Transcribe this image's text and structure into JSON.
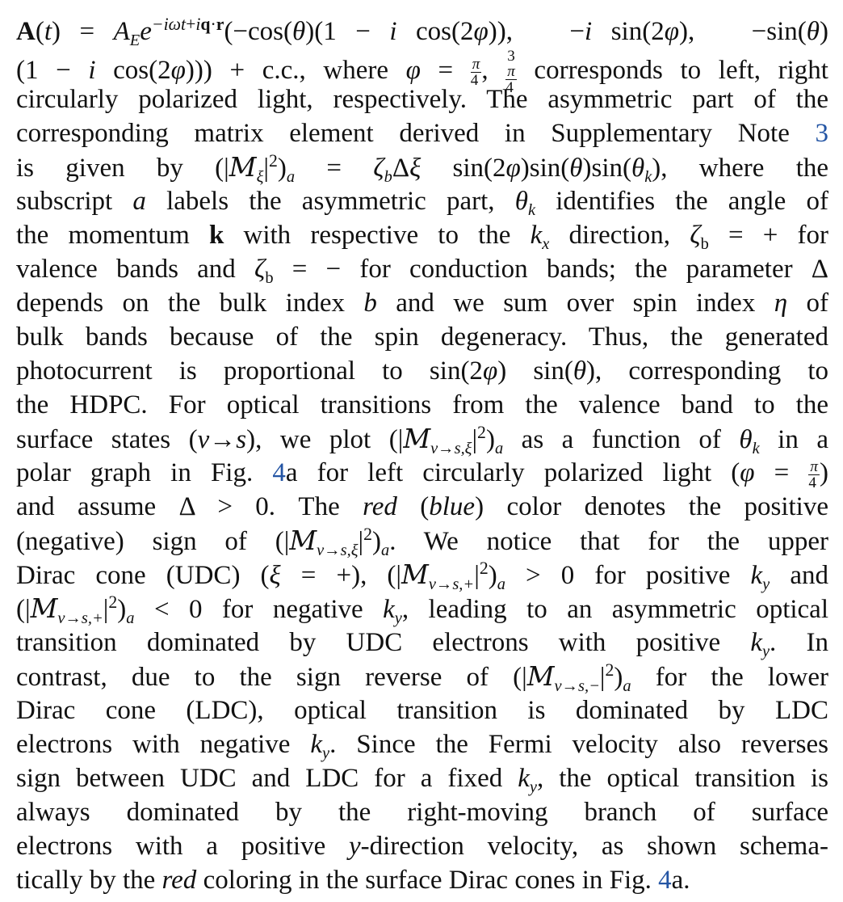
{
  "paragraph": {
    "lines": [
      "A(t) = A_E e^{−iωt+iq·r}(−cos(θ)(1 − i cos(2φ)),  −i sin(2φ),  −sin(θ)",
      "(1 − i cos(2φ))) + c.c., where φ = π/4, 3π/4 corresponds to left, right",
      "circularly polarized light, respectively. The asymmetric part of the",
      "corresponding matrix element derived in Supplementary Note 3",
      "is given by (|M_ξ|²)_a = ζ_b Δξ sin(2φ)sin(θ)sin(θ_k), where the",
      "subscript a labels the asymmetric part, θ_k identifies the angle of",
      "the momentum k with respective to the k_x direction, ζ_b = + for",
      "valence bands and ζ_b = − for conduction bands; the parameter Δ",
      "depends on the bulk index b and we sum over spin index η of",
      "bulk bands because of the spin degeneracy. Thus, the generated",
      "photocurrent is proportional to sin(2φ) sin(θ), corresponding to",
      "the HDPC. For optical transitions from the valence band to the",
      "surface states (v→s), we plot (|M_{v→s,ξ}|²)_a as a function of θ_k in a",
      "polar graph in Fig. 4a for left circularly polarized light (φ = π/4)",
      "and assume Δ > 0. The red (blue) color denotes the positive",
      "(negative) sign of (|M_{v→s,ξ}|²)_a. We notice that for the upper",
      "Dirac cone (UDC) (ξ = +), (|M_{v→s,+}|²)_a > 0 for positive k_y and",
      "(|M_{v→s,+}|²)_a < 0 for negative k_y, leading to an asymmetric optical",
      "transition dominated by UDC electrons with positive k_y. In",
      "contrast, due to the sign reverse of (|M_{v→s,−}|²)_a for the lower",
      "Dirac cone (LDC), optical transition is dominated by LDC",
      "electrons with negative k_y. Since the Fermi velocity also reverses",
      "sign between UDC and LDC for a fixed k_y, the optical transition is",
      "always dominated by the right-moving branch of surface",
      "electrons with a positive y-direction velocity, as shown schema-",
      "tically by the red coloring in the surface Dirac cones in Fig. 4a."
    ]
  },
  "references": {
    "supplementary_note": "3",
    "figure_ref_1": "4",
    "figure_ref_2": "4"
  },
  "colors": {
    "text": "#111111",
    "link": "#2455a4",
    "background": "#ffffff"
  }
}
